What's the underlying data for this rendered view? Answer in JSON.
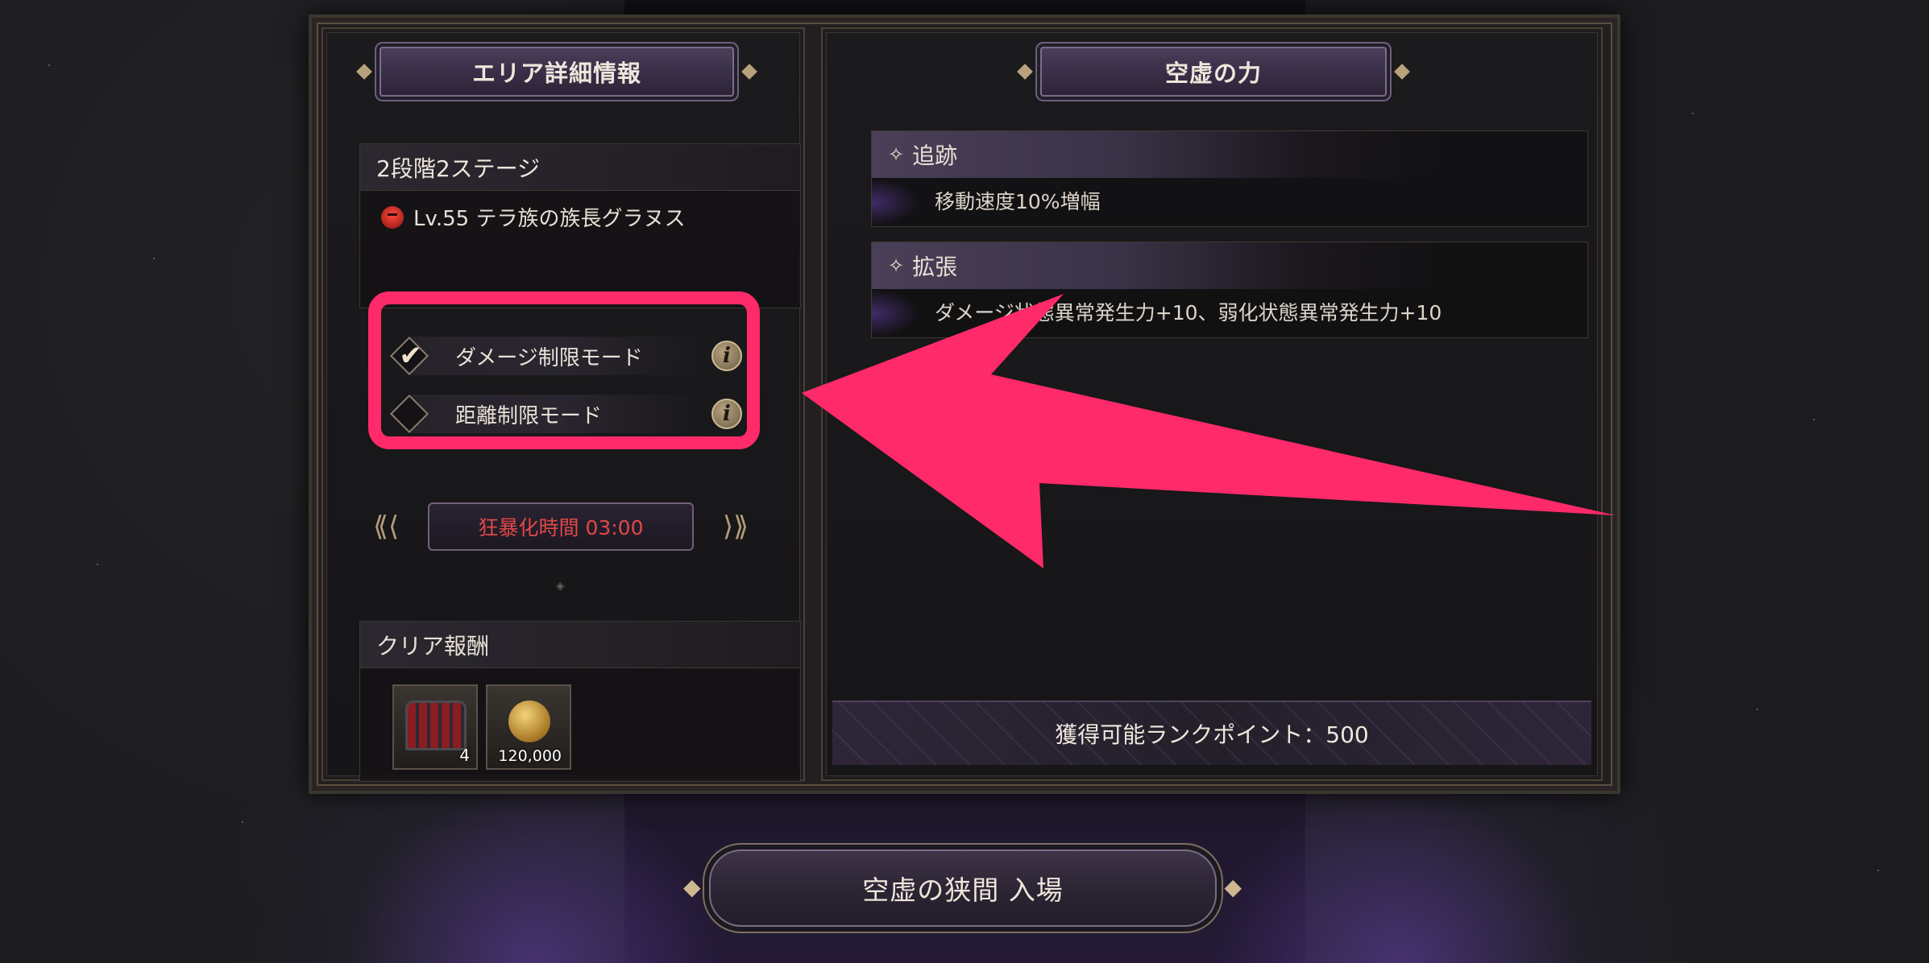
{
  "left_panel": {
    "title": "エリア詳細情報",
    "stage": {
      "name": "2段階2ステージ",
      "boss": "Lv.55 テラ族の族長グラヌス"
    },
    "modes": [
      {
        "label": "ダメージ制限モード",
        "checked": true
      },
      {
        "label": "距離制限モード",
        "checked": false
      }
    ],
    "rage_timer": "狂暴化時間 03:00",
    "rewards": {
      "title": "クリア報酬",
      "items": [
        {
          "icon": "treasure-chest-icon",
          "quantity": "4"
        },
        {
          "icon": "gold-coin-icon",
          "quantity": "120,000"
        }
      ]
    }
  },
  "right_panel": {
    "title": "空虚の力",
    "effects": [
      {
        "name": "追跡",
        "description": "移動速度10%増幅"
      },
      {
        "name": "拡張",
        "description": "ダメージ状態異常発生力+10、弱化状態異常発生力+10"
      }
    ],
    "rank_points": "獲得可能ランクポイント：500"
  },
  "enter_button": "空虚の狭間 入場",
  "annotation": {
    "color": "#ff2a6a"
  }
}
